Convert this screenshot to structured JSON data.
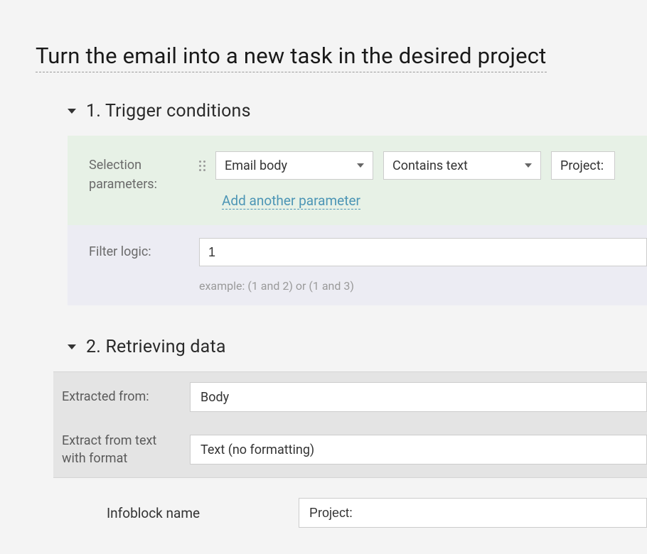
{
  "title": "Turn the email into a new task in the desired project",
  "section1": {
    "heading": "1. Trigger conditions",
    "selection_params_label": "Selection parameters:",
    "param1_field": "Email body",
    "param1_op": "Contains text",
    "param1_value": "Project:",
    "add_another": "Add another parameter",
    "filter_logic_label": "Filter logic:",
    "filter_logic_value": "1",
    "filter_logic_hint": "example: (1 and 2) or (1 and 3)"
  },
  "section2": {
    "heading": "2. Retrieving data",
    "extracted_from_label": "Extracted from:",
    "extracted_from_value": "Body",
    "extract_format_label": "Extract from text with format",
    "extract_format_value": "Text (no formatting)",
    "infoblock_label": "Infoblock name",
    "infoblock_value": "Project:"
  }
}
